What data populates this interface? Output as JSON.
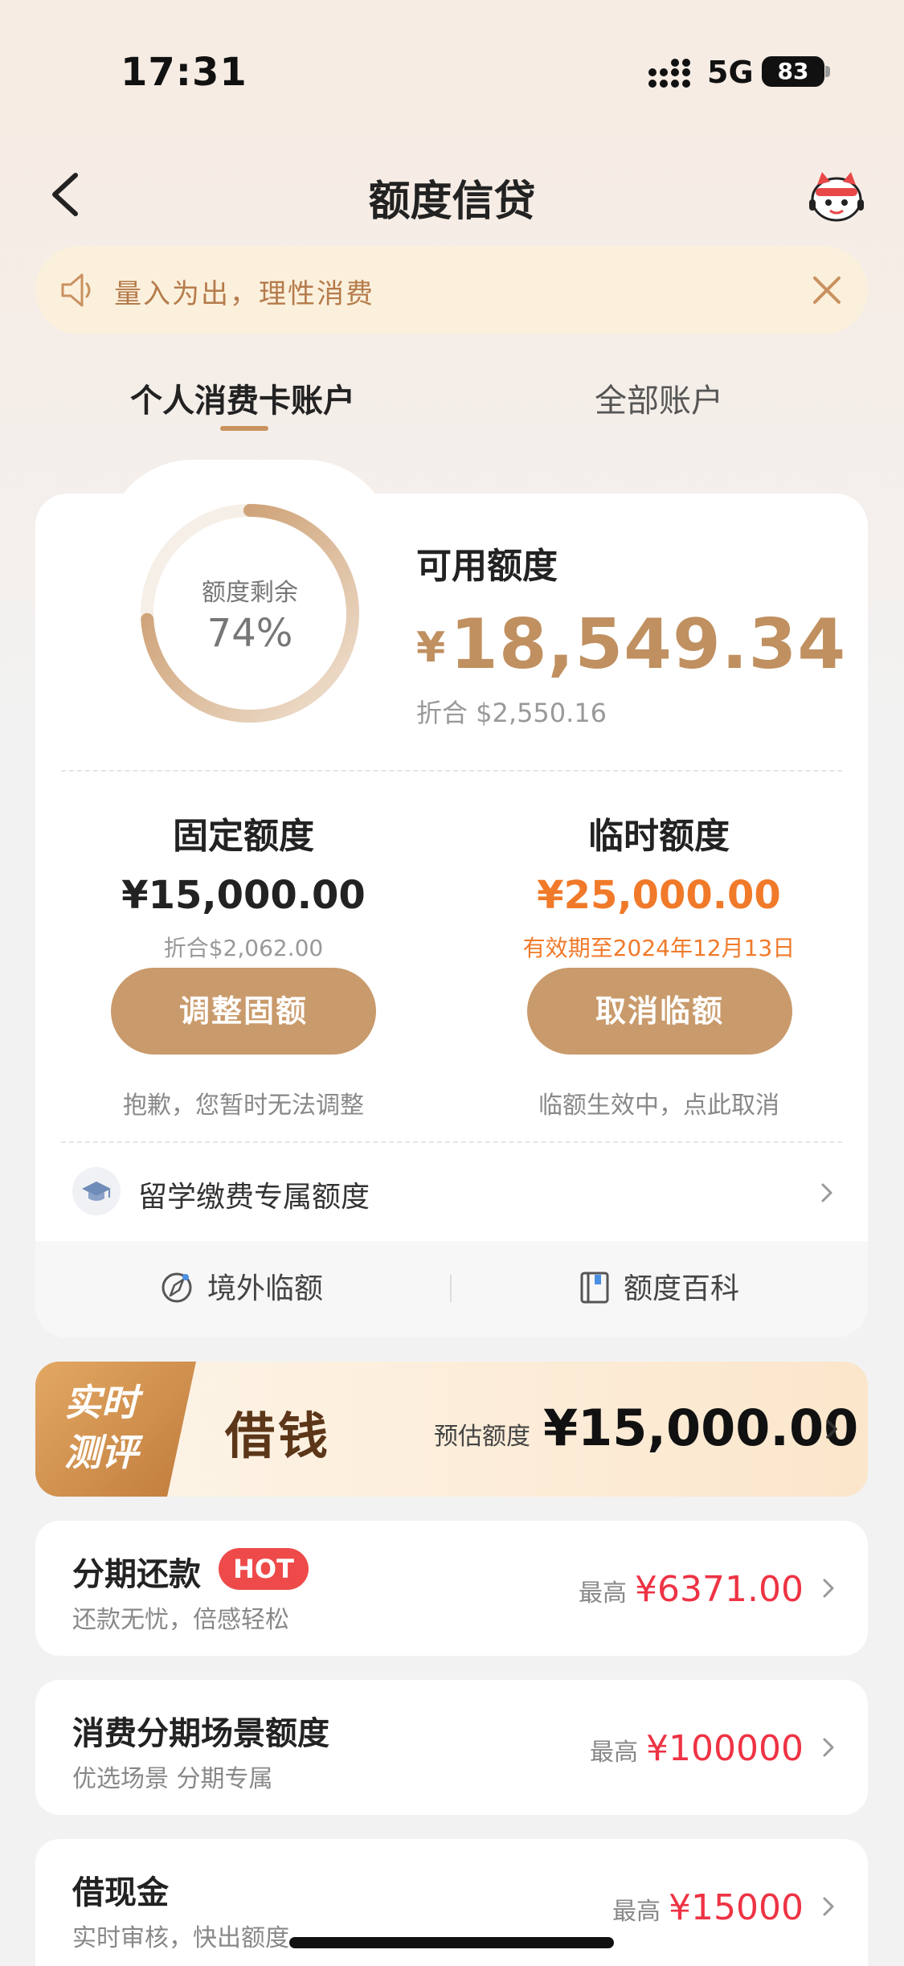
{
  "status_bar": {
    "time": "17:31",
    "network": "5G",
    "battery": "83"
  },
  "nav": {
    "title": "额度信贷"
  },
  "notice": {
    "text": "量入为出，理性消费"
  },
  "tabs": [
    {
      "label": "个人消费卡账户",
      "active": true
    },
    {
      "label": "全部账户",
      "active": false
    }
  ],
  "credit": {
    "ring_label": "额度剩余",
    "ring_value": "74%",
    "ring_fraction": 0.74,
    "available_label": "可用额度",
    "currency_symbol": "¥",
    "available_amount": "18,549.34",
    "available_usd": "折合  $2,550.16",
    "fixed": {
      "title": "固定额度",
      "amount": "¥15,000.00",
      "sub": "折合$2,062.00",
      "button": "调整固额",
      "note": "抱歉，您暂时无法调整"
    },
    "temp": {
      "title": "临时额度",
      "amount": "¥25,000.00",
      "sub": "有效期至2024年12月13日",
      "button": "取消临额",
      "note": "临额生效中，点此取消"
    },
    "study_abroad": "留学缴费专属额度",
    "footer": [
      {
        "label": "境外临额",
        "icon": "compass-icon"
      },
      {
        "label": "额度百科",
        "icon": "book-icon"
      }
    ]
  },
  "loan_banner": {
    "badge_line1": "实时",
    "badge_line2": "测评",
    "title": "借钱",
    "estimate_label": "预估额度",
    "estimate_value": "¥15,000.00"
  },
  "products": [
    {
      "title": "分期还款",
      "badge": "HOT",
      "subtitle": "还款无忧，倍感轻松",
      "max_label": "最高",
      "max_value": "¥6371.00"
    },
    {
      "title": "消费分期场景额度",
      "subtitle": "优选场景 分期专属",
      "max_label": "最高",
      "max_value": "¥100000"
    },
    {
      "title": "借现金",
      "subtitle": "实时审核，快出额度",
      "max_label": "最高",
      "max_value": "¥15000"
    }
  ],
  "colors": {
    "accent": "#c99a6b",
    "gold_text": "#c09060",
    "orange": "#f07a2a",
    "red": "#ee3344",
    "notice_bg": "#fbf0dc"
  }
}
